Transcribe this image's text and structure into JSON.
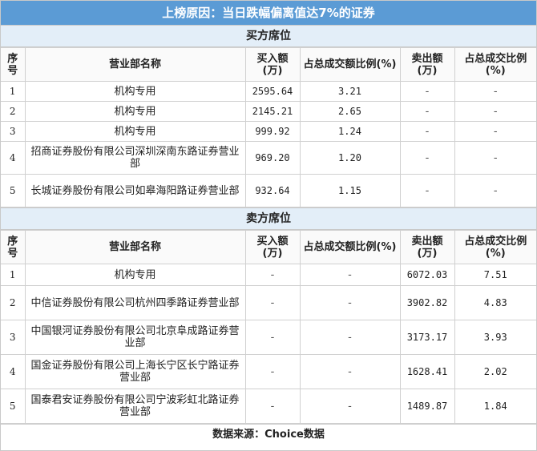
{
  "title": "上榜原因：当日跌幅偏离值达7%的证券",
  "buy_section": "买方席位",
  "sell_section": "卖方席位",
  "headers": {
    "idx": "序号",
    "name": "营业部名称",
    "buy_amt": "买入额(万)",
    "buy_pct": "占总成交额比例(%)",
    "sell_amt": "卖出额(万)",
    "sell_pct": "占总成交比例(%)"
  },
  "buy_rows": [
    {
      "idx": "1",
      "name": "机构专用",
      "buy_amt": "2595.64",
      "buy_pct": "3.21",
      "sell_amt": "-",
      "sell_pct": "-"
    },
    {
      "idx": "2",
      "name": "机构专用",
      "buy_amt": "2145.21",
      "buy_pct": "2.65",
      "sell_amt": "-",
      "sell_pct": "-"
    },
    {
      "idx": "3",
      "name": "机构专用",
      "buy_amt": "999.92",
      "buy_pct": "1.24",
      "sell_amt": "-",
      "sell_pct": "-"
    },
    {
      "idx": "4",
      "name": "招商证券股份有限公司深圳深南东路证券营业部",
      "buy_amt": "969.20",
      "buy_pct": "1.20",
      "sell_amt": "-",
      "sell_pct": "-"
    },
    {
      "idx": "5",
      "name": "长城证券股份有限公司如皋海阳路证券营业部",
      "buy_amt": "932.64",
      "buy_pct": "1.15",
      "sell_amt": "-",
      "sell_pct": "-"
    }
  ],
  "sell_rows": [
    {
      "idx": "1",
      "name": "机构专用",
      "buy_amt": "-",
      "buy_pct": "-",
      "sell_amt": "6072.03",
      "sell_pct": "7.51"
    },
    {
      "idx": "2",
      "name": "中信证券股份有限公司杭州四季路证券营业部",
      "buy_amt": "-",
      "buy_pct": "-",
      "sell_amt": "3902.82",
      "sell_pct": "4.83"
    },
    {
      "idx": "3",
      "name": "中国银河证券股份有限公司北京阜成路证券营业部",
      "buy_amt": "-",
      "buy_pct": "-",
      "sell_amt": "3173.17",
      "sell_pct": "3.93"
    },
    {
      "idx": "4",
      "name": "国金证券股份有限公司上海长宁区长宁路证券营业部",
      "buy_amt": "-",
      "buy_pct": "-",
      "sell_amt": "1628.41",
      "sell_pct": "2.02"
    },
    {
      "idx": "5",
      "name": "国泰君安证券股份有限公司宁波彩虹北路证券营业部",
      "buy_amt": "-",
      "buy_pct": "-",
      "sell_amt": "1489.87",
      "sell_pct": "1.84"
    }
  ],
  "footer": "数据来源：Choice数据"
}
